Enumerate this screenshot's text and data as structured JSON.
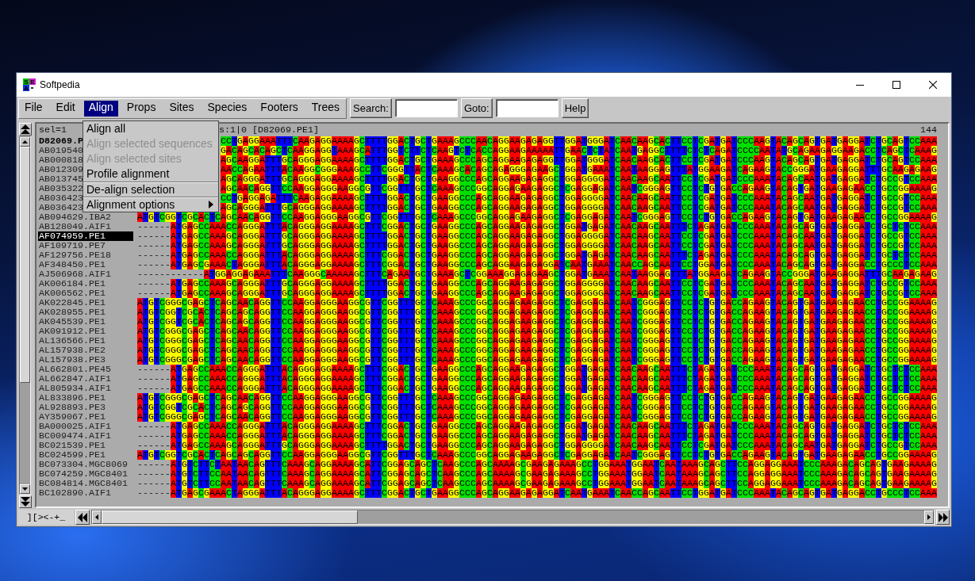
{
  "window": {
    "title": "Softpedia",
    "icon_letters": [
      "S",
      "E",
      "A"
    ]
  },
  "menu_bar": [
    {
      "label": "File",
      "selected": false
    },
    {
      "label": "Edit",
      "selected": false
    },
    {
      "label": "Align",
      "selected": true
    },
    {
      "label": "Props",
      "selected": false
    },
    {
      "label": "Sites",
      "selected": false
    },
    {
      "label": "Species",
      "selected": false
    },
    {
      "label": "Footers",
      "selected": false
    },
    {
      "label": "Trees",
      "selected": false
    }
  ],
  "toolbar": {
    "search_button": "Search:",
    "goto_button": "Goto:",
    "help_button": "Help"
  },
  "align_menu": [
    {
      "label": "Align all",
      "kind": "action",
      "disabled": false,
      "separator_before": false
    },
    {
      "label": "Align selected sequences",
      "kind": "action",
      "disabled": true,
      "separator_before": false
    },
    {
      "label": "Align selected sites",
      "kind": "action",
      "disabled": true,
      "separator_before": false
    },
    {
      "label": "Profile alignment",
      "kind": "action",
      "disabled": false,
      "separator_before": false
    },
    {
      "label": "De-align selection",
      "kind": "action",
      "disabled": false,
      "separator_before": true
    },
    {
      "label": "Alignment options",
      "kind": "submenu",
      "disabled": false,
      "separator_before": true
    }
  ],
  "alignment": {
    "selection_count": "sel=1",
    "status": "s:1|0 [D82069.PE1]",
    "column_count": "144",
    "rows": [
      {
        "name": "D82069.P",
        "selected": false,
        "reference": true,
        "sequence": "CCTGAGGAAATTTCAAGAGGAAAAGCTTTTGGACTGCTGAAAGCCCAACAGGAAGAGAGGTTGGATGGGATCAACAAGCACTTCCTCGATGATCCCAAGTACAGCAGTGATGAGGATCTGCAGTCCAAA"
      },
      {
        "name": "AB019540",
        "selected": false,
        "reference": false,
        "sequence": "GACAGCACAGCTCAAGGAGGTAAAGCATTTGGTCTTCTCAAGTCTCACCAGGAAGAAAAATTGAACTCTATCAATGAGGCTTTTCTCTCAGATCCCCAATATGCAGAAGAGGAAGACCTCAGCTCAAAG"
      },
      {
        "name": "AB000818",
        "selected": false,
        "reference": false,
        "sequence": "AGCAAGGATTTGCAGGGAGGAAAAGCTTTTGGACTGCTGAAAGCCCAGCAGGAAGAGAGGTTGGATGGGATCAACAAGCACTTCCTCGATGATCCCAAGTACAGCAGTGATGAGGATCTGCAGTCCAAA"
      },
      {
        "name": "AB012309",
        "selected": false,
        "reference": false,
        "sequence": "AACCAGAATTTACAAGGCGGGAAAGCCTTCGGGTTACTCAAAGCACAGCAGAGGGAGAAGCTGGATGAAATCAATAAGGAGTTTATGGAAGATCAGAAGTACCGGGATGAAGAGGATTTGCAAGAGAAG"
      },
      {
        "name": "AB013745",
        "selected": false,
        "reference": false,
        "sequence": "AGCAGGGATTTGCAGGGAGGAAAAGCTTTTGGACTGCTGAAGGCCCAGCAGGAAGAGAGGCTGGAGGGGATCAACAAGCAATTCCTCGATGATCCCAAATACAGCAATGATGAGGATCTGCCGTCCAAA"
      },
      {
        "name": "AB035322",
        "selected": false,
        "reference": false,
        "sequence": "AGCAACAGGTTCCAAGGAGGGAAGGCGTTCGGTTTGCTCAAAGCCCGGCAGGAGAAGAGGCTCGAGGAGATCAATCGGGAGTTCCTCTGTGACCAGAAGTACAGTGATGAAGAGAACCTGCCGGAAAAG"
      },
      {
        "name": "AB036423",
        "selected": false,
        "reference": false,
        "sequence": "CCTGAGGAGATTTCAAGAGGAAAAGCTTTTGGACTGCTGAAGGCCCAGCAGGAAGAGAGGCTGGAGGGGATCAACAAGCAATTCCTCGATGATCCCAAATACAGCAATGATGAGGATCTGCCGTCCAAA"
      },
      {
        "name": "AB036423",
        "selected": false,
        "reference": false,
        "sequence": "AGCAGGGATTTGCAGGGAGGAAAAGCTTTTGGACTGCTGAAGGCCCAGCAGGAAGAGAGGCTGGAGGGGATCAACAAGCAATTCCTCGATGATCCCAAATACAGCAATGATGAGGATCTGCCGTCCAAA"
      },
      {
        "name": "AB094629.IBA2",
        "selected": false,
        "reference": false,
        "sequence": "ATGTCGGTCGCACTCAGCAACAGGTTCCAAGGAGGGAAGGCGTTCGGTTTGCTCAAAGCCCGGCAGGAGAAGAGGCTCGAGGAGATCAATCGGGAGTTCCTCTGTGACCAGAAGTACAGTGATGAAGAGAACCTGCCGGAAAAG"
      },
      {
        "name": "AB128049.AIF1",
        "selected": false,
        "reference": false,
        "sequence": "------ATGAGCCAAACCAGGGATTTACAGGGAGGAAAAGCTTTCGGACTGCTGAAGGCCCAGCAGGAAGAGAGGCTGGATGAGATCAACAAGCAATTTCTAGATGATCCCAAATACAGCAGTGATGAGGATCTGCTCTCCAAA"
      },
      {
        "name": "AF074959.PE1",
        "selected": true,
        "reference": false,
        "sequence": "------ATGAGCCAAAGCAGGGATTTGCAGGGAGGAAAAGCTTTTGGACTGCTGAAGGCCCAGCAGGAAGAGAGGCTGGAGGGGATCAACAAGCAATTCCTCGATGATCCCAAATACAGCAATGATGAGGATCTGCCGTCCAAA"
      },
      {
        "name": "AF109719.PE7",
        "selected": false,
        "reference": false,
        "sequence": "------ATGAGCCAAAGCAGGGATTTGCAGGGAGGAAAAGCTTTTGGACTGCTGAAGGCCCAGCAGGAAGAGAGGCTGGAGGGGATCAACAAGCAATTCCTCGATGATCCCAAATACAGCAATGATGAGGATCTGCCGTCCAAA"
      },
      {
        "name": "AF129756.PE18",
        "selected": false,
        "reference": false,
        "sequence": "------ATGAGCCAAACCAGGGATTTACAGGGAGGAAAAGCTTTCGGACTGCTGAAGGCCCAGCAGGAAGAGAGGCTGGATGAGATCAACAAGCAATTTCTAGATGATCCCAAATACAGCAGTGATGAGGATCTGCTCTCCAAA"
      },
      {
        "name": "AF348450.PE1",
        "selected": false,
        "reference": false,
        "sequence": "------ATGAGCGAAACTAGGGATTTACAGGGAGGAAAAGCTTTCGGACTGCTGAAGGCCCAGCAGGAAGAGAGGATCAATGAAATCAACCAGCAATTCCTGGATGATCCCAAATACAGCAGTGATGAGGACCTGCCCTCCAAA"
      },
      {
        "name": "AJ506968.AIF1",
        "selected": false,
        "reference": false,
        "sequence": "------------ATGGAGGAGAAATTTCAAGGGCAAAAAGCTTTCAGAATGCTGAAAGCTCGGAAAGGAGAGAAGCTGGATGAAATCAATAAGGAGTTTATGGAAGATCAGAAGTACCGGGATGAAGAGGATTTGCAAGAGAAG"
      },
      {
        "name": "AK006184.PE1",
        "selected": false,
        "reference": false,
        "sequence": "------ATGAGCCAAAGCAGGGATTTGCAGGGAGGAAAAGCTTTTGGACTGCTGAAGGCCCAGCAGGAAGAGAGGCTGGAGGGGATCAACAAGCAATTCCTCGATGATCCCAAATACAGCAATGATGAGGATCTGCCGTCCAAA"
      },
      {
        "name": "AK006562.PE1",
        "selected": false,
        "reference": false,
        "sequence": "------ATGAGCCAAAGCAGGGATTTGCAGGGAGGAAAAGCTTTTGGACTGCTGAAGGCCCAGCAGGAAGAGAGGCTGGAGGGGATCAACAAGCAATTCCTCGATGATCCCAAATACAGCAATGATGAGGATCTGCCGTCCAAA"
      },
      {
        "name": "AK022845.PE1",
        "selected": false,
        "reference": false,
        "sequence": "ATGTCGGGCGAGCTCAGCAACAGGTTCCAAGGAGGGAAGGCGTTCGGTTTGCTCAAAGCCCGGCAGGAGAAGAGGCTCGAGGAGATCAATCGGGAGTTCCTCTGTGACCAGAAGTACAGTGATGAAGAGAACCTGCCGGAAAAG"
      },
      {
        "name": "AK028955.PE1",
        "selected": false,
        "reference": false,
        "sequence": "ATGTCGGTCGCACTCAGCAGCAGGTTCCAAGGAGGGAAGGCGTTCGGTTTGCTCAAAGCCCGGCAGGAGAAGAGGCTCGAGGAGATCAATCGGGAGTTCCTCTGTGACCAGAAGTACAGTGATGAAGAGAACCTGCCGGAAAAG"
      },
      {
        "name": "AK045539.PE1",
        "selected": false,
        "reference": false,
        "sequence": "ATGTCGGTCGCACTCAGCAGCAGGTTCCAAGGAGGGAAGGCGTTCGGTTTGCTCAAAGCCCGGCAGGAGAAGAGGCTCGAGGAGATCAATCGGGAGTTCCTCTGTGACCAGAAGTACAGTGATGAAGAGAACCTGCCGGAAAAG"
      },
      {
        "name": "AK091912.PE1",
        "selected": false,
        "reference": false,
        "sequence": "ATGTCGGGCGAGCTCAGCAACAGGTTCCAAGGAGGGAAGGCGTTCGGTTTGCTCAAAGCCCGGCAGGAGAAGAGGCTCGAGGAGATCAATCGGGAGTTCCTCTGTGACCAGAAGTACAGTGATGAAGAGAACCTGCCGGAAAAG"
      },
      {
        "name": "AL136566.PE1",
        "selected": false,
        "reference": false,
        "sequence": "ATGTCGGGCGAGCTCAGCAACAGGTTCCAAGGAGGGAAGGCGTTCGGTTTGCTCAAAGCCCGGCAGGAGAAGAGGCTCGAGGAGATCAATCGGGAGTTCCTCTGTGACCAGAAGTACAGTGATGAAGAGAACCTGCCGGAAAAG"
      },
      {
        "name": "AL157938.PE2",
        "selected": false,
        "reference": false,
        "sequence": "ATGTCGGGCGAGCTCAGCAACAGGTTCCAAGGAGGGAAGGCGTTCGGTTTGCTCAAAGCCCGGCAGGAGAAGAGGCTCGAGGAGATCAATCGGGAGTTCCTCTGTGACCAGAAGTACAGTGATGAAGAGAACCTGCCGGAAAAG"
      },
      {
        "name": "AL157938.PE3",
        "selected": false,
        "reference": false,
        "sequence": "ATGTCGGGCGAGCTCAGCAACAGGTTCCAAGGAGGGAAGGCGTTCGGTTTGCTCAAAGCCCGGCAGGAGAAGAGGCTCGAGGAGATCAATCGGGAGTTCCTCTGTGACCAGAAGTACAGTGATGAAGAGAACCTGCCGGAAAAG"
      },
      {
        "name": "AL662801.PE45",
        "selected": false,
        "reference": false,
        "sequence": "------ATGAGCCAAACCAGGGATTTACAGGGAGGAAAAGCTTTCGGACTGCTGAAGGCCCAGCAGGAAGAGAGGCTGGATGAGATCAACAAGCAATTTCTAGATGATCCCAAATACAGCAGTGATGAGGATCTGCTCTCCAAA"
      },
      {
        "name": "AL662847.AIF1",
        "selected": false,
        "reference": false,
        "sequence": "------ATGAGCCAAACCAGGGATTTACAGGGAGGAAAAGCTTTCGGACTGCTGAAGGCCCAGCAGGAAGAGAGGCTGGATGAGATCAACAAGCAATTTCTAGATGATCCCAAATACAGCAGTGATGAGGATCTGCTCTCCAAA"
      },
      {
        "name": "AL805934.AIF1",
        "selected": false,
        "reference": false,
        "sequence": "------ATGAGCCAAACCAGGGATTTACAGGGAGGAAAAGCTTTCGGACTGCTGAAGGCCCAGCAGGAAGAGAGGCTGGATGAGATCAACAAGCAATTTCTAGATGATCCCAAATACAGCAGTGATGAGGATCTGCTCTCCAAA"
      },
      {
        "name": "AL833896.PE1",
        "selected": false,
        "reference": false,
        "sequence": "ATGTCGGGCGAGCTCAGCAACAGGTTCCAAGGAGGGAAGGCGTTCGGTTTGCTCAAAGCCCGGCAGGAGAAGAGGCTCGAGGAGATCAATCGGGAGTTCCTCTGTGACCAGAAGTACAGTGATGAAGAGAACCTGCCGGAAAAG"
      },
      {
        "name": "AL928893.PE3",
        "selected": false,
        "reference": false,
        "sequence": "ATGTCGGTCGCACTCAGCAGCAGGTTCCAAGGAGGGAAGGCGTTCGGTTTGCTCAAAGCCCGGCAGGAGAAGAGGCTCGAGGAGATCAATCGGGAGTTCCTCTGTGACCAGAAGTACAGTGATGAAGAGAACCTGCCGGAAAAG"
      },
      {
        "name": "AY359067.PE1",
        "selected": false,
        "reference": false,
        "sequence": "ATGTCGGGCGAGCTCAGCAACAGGTTCCAAGGAGGGAAGGCGTTCGGTTTGCTCAAAGCCCGGCAGGAGAAGAGGCTCGAGGAGATCAATCGGGAGTTCCTCTGTGACCAGAAGTACAGTGATGAAGAGAACCTGCCGGAAAAG"
      },
      {
        "name": "BA000025.AIF1",
        "selected": false,
        "reference": false,
        "sequence": "------ATGAGCCAAACCAGGGATTTACAGGGAGGAAAAGCTTTCGGACTGCTGAAGGCCCAGCAGGAAGAGAGGCTGGATGAGATCAACAAGCAATTTCTAGATGATCCCAAATACAGCAGTGATGAGGATCTGCTCTCCAAA"
      },
      {
        "name": "BC009474.AIF1",
        "selected": false,
        "reference": false,
        "sequence": "------ATGAGCCAAACCAGGGATTTACAGGGAGGAAAAGCTTTCGGACTGCTGAAGGCCCAGCAGGAAGAGAGGCTGGATGAGATCAACAAGCAATTTCTAGATGATCCCAAATACAGCAGTGATGAGGATCTGCTCTCCAAA"
      },
      {
        "name": "BC021539.PE1",
        "selected": false,
        "reference": false,
        "sequence": "------ATGAGCCAAAGCAGGGATTTGCAGGGAGGAAAAGCTTTTGGACTGCTGAAGGCCCAGCAGGAAGAGAGGCTGGAGGGGATCAACAAGCAATTCCTCGATGATCCCAAATACAGCAATGATGAGGATCTGCCGTCCAAA"
      },
      {
        "name": "BC024599.PE1",
        "selected": false,
        "reference": false,
        "sequence": "ATGTCGGTCGCACTCAGCAGCAGGTTCCAAGGAGGGAAGGCGTTCGGTTTGCTCAAAGCCCGGCAGGAGAAGAGGCTCGAGGAGATCAATCGGGAGTTCCTCTGTGACCAGAAGTACAGTGATGAAGAGAACCTGCCGGAAAAG"
      },
      {
        "name": "BC073304.MGC8069",
        "selected": false,
        "reference": false,
        "sequence": "------ATGTCTTCTAATAACAGTTTCAAAGCAGGAAAAGCATTCGGAGCAGCTCAAGCCCAGCAAAAGCGAAGAGAAAGCCTGGAAATGGAATCAATAAAGCAGCTTCCAGGAGGAAATCCCAAAGACAGCAGTGAAGAAAAG"
      },
      {
        "name": "BC074259.MGC8401",
        "selected": false,
        "reference": false,
        "sequence": "------ATGTCTTCCAATAACAGTTTCAAAGCAGGAAAAGCATTCGGAGCAGCTCAAGCCCAGCAAAAGCGAAGAGAAAGCCTGGAAATGGAATCAATAAAGCAGCTTCCAGGAGGAAATCCCAAAGACAGCAGTGAAGAAAAG"
      },
      {
        "name": "BC084814.MGC8401",
        "selected": false,
        "reference": false,
        "sequence": "------ATGTCTTCCAATAACAGTTTCAAAGCAGGAAAAGCATTCGGAGCAGCTCAAGCCCAGCAAAAGCGAAGAGAAAGCCTGGAAATGGAATCAATAAAGCAGCTTCCAGGAGGAAATCCCAAAGACAGCAGTGAAGAAAAG"
      },
      {
        "name": "BC102890.AIF1",
        "selected": false,
        "reference": false,
        "sequence": "------ATGAGCGAAACTAGGGATTTACAGGGAGGAAAAGCTTTCGGACTGCTGAAGGCCCAGCAGGAAGAGAGGATCAATGAAATCAACCAGCAATTCCTGGATGATCCCAAATACAGCAGTGATGAGGACCTGCCCTCCAAA"
      }
    ]
  },
  "bottom_bar": {
    "mode_label": "][><-+_"
  }
}
